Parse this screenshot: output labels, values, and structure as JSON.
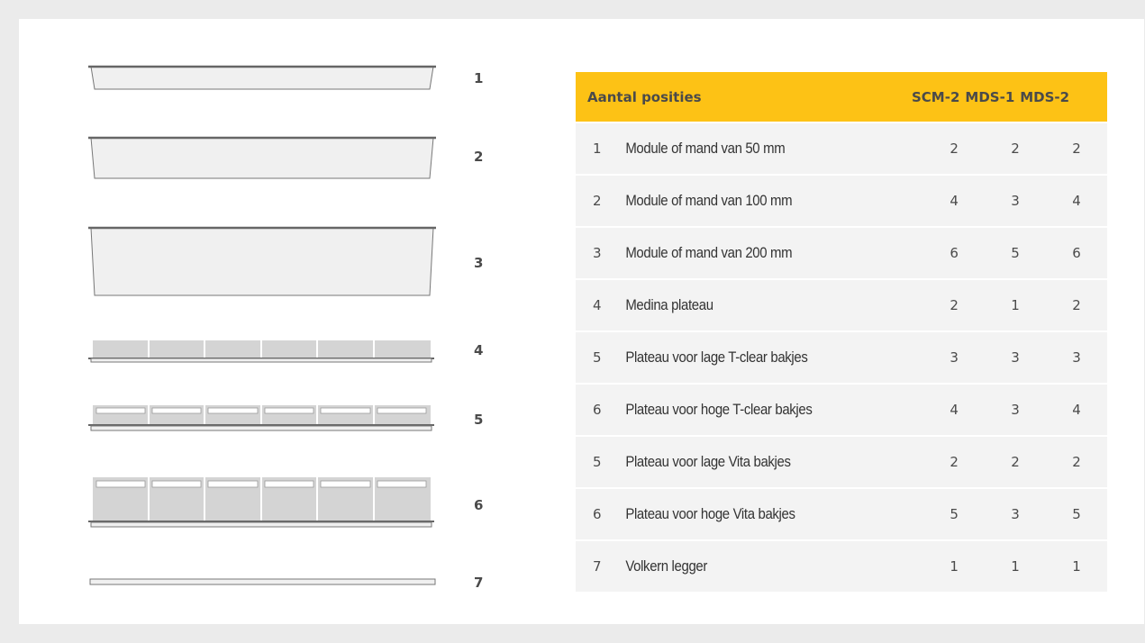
{
  "illustrations": [
    {
      "number": "1",
      "kind": "tray-50"
    },
    {
      "number": "2",
      "kind": "tray-100"
    },
    {
      "number": "3",
      "kind": "tray-200"
    },
    {
      "number": "4",
      "kind": "medina-plateau"
    },
    {
      "number": "5",
      "kind": "plateau-low-bins"
    },
    {
      "number": "6",
      "kind": "plateau-high-bins"
    },
    {
      "number": "7",
      "kind": "volkern-legger"
    }
  ],
  "table": {
    "header": {
      "label": "Aantal posities",
      "columns": [
        "SCM-2",
        "MDS-1",
        "MDS-2"
      ]
    },
    "rows": [
      {
        "index": "1",
        "desc": "Module of mand van 50 mm",
        "values": [
          "2",
          "2",
          "2"
        ]
      },
      {
        "index": "2",
        "desc": "Module of mand van 100 mm",
        "values": [
          "4",
          "3",
          "4"
        ]
      },
      {
        "index": "3",
        "desc": "Module of mand van 200 mm",
        "values": [
          "6",
          "5",
          "6"
        ]
      },
      {
        "index": "4",
        "desc": "Medina plateau",
        "values": [
          "2",
          "1",
          "2"
        ]
      },
      {
        "index": "5",
        "desc": "Plateau voor lage T-clear bakjes",
        "values": [
          "3",
          "3",
          "3"
        ]
      },
      {
        "index": "6",
        "desc": "Plateau voor hoge T-clear bakjes",
        "values": [
          "4",
          "3",
          "4"
        ]
      },
      {
        "index": "5",
        "desc": "Plateau voor lage Vita bakjes",
        "values": [
          "2",
          "2",
          "2"
        ]
      },
      {
        "index": "6",
        "desc": "Plateau voor hoge Vita bakjes",
        "values": [
          "5",
          "3",
          "5"
        ]
      },
      {
        "index": "7",
        "desc": "Volkern legger",
        "values": [
          "1",
          "1",
          "1"
        ]
      }
    ]
  },
  "colors": {
    "header_bg": "#fdc215",
    "row_bg": "#f3f3f3",
    "page_bg": "#ebebeb",
    "shape_fill": "#eeeeee",
    "bin_fill": "#d4d4d4",
    "outline": "#6d6d6d"
  }
}
